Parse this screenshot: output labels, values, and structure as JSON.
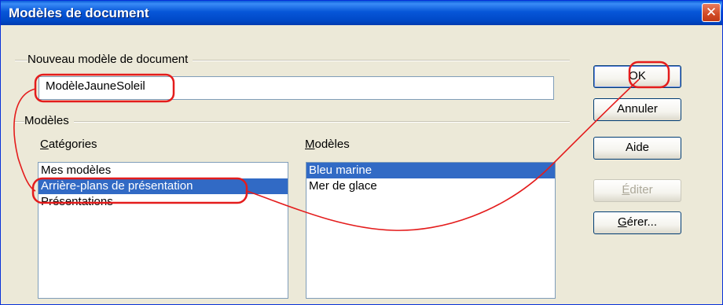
{
  "window": {
    "title": "Modèles de document",
    "close_glyph": "✕"
  },
  "new_template": {
    "label": "Nouveau modèle de document",
    "value": "ModèleJauneSoleil"
  },
  "templates_group": {
    "label": "Modèles"
  },
  "categories": {
    "label_u": "C",
    "label_rest": "atégories",
    "items": [
      {
        "label": "Mes modèles",
        "selected": false
      },
      {
        "label": "Arrière-plans de présentation",
        "selected": true
      },
      {
        "label": "Présentations",
        "selected": false
      }
    ]
  },
  "models": {
    "label_u": "M",
    "label_rest": "odèles",
    "items": [
      {
        "label": "Bleu marine",
        "selected": true
      },
      {
        "label": "Mer de glace",
        "selected": false
      }
    ]
  },
  "buttons": {
    "ok": "OK",
    "cancel": "Annuler",
    "help": "Aide",
    "edit_u": "É",
    "edit_rest": "diter",
    "manage_u": "G",
    "manage_rest": "érer..."
  },
  "colors": {
    "annotation": "#e41c1c",
    "selection": "#316ac5",
    "titlebar": "#0756d8"
  }
}
